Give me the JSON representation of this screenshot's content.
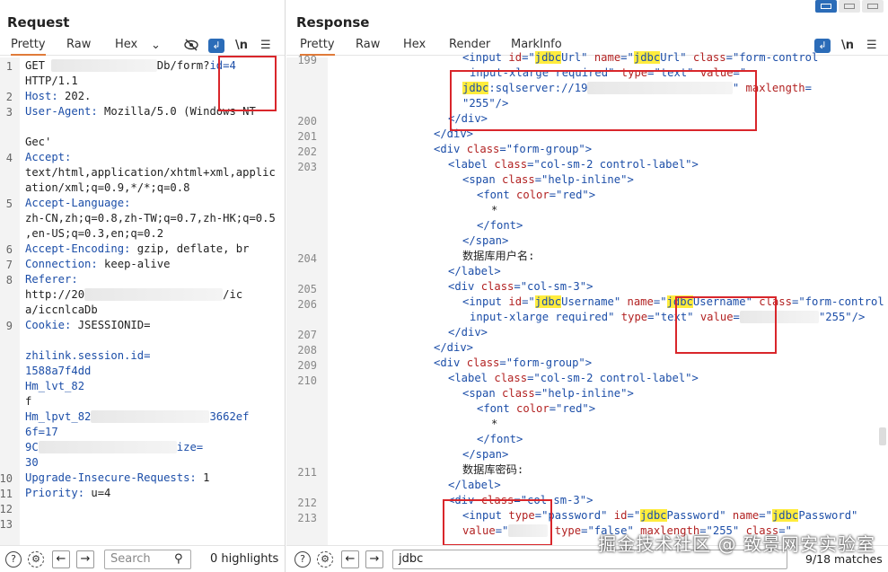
{
  "request": {
    "title": "Request",
    "tabs": [
      "Pretty",
      "Raw",
      "Hex"
    ],
    "newline_toggle": "\\n",
    "lines": [
      {
        "n": "1",
        "text": "GET "
      },
      {
        "n": "",
        "text": "HTTP/1.1"
      },
      {
        "n": "2",
        "text": "Host: 202."
      },
      {
        "n": "3",
        "text": "User-Agent: Mozilla/5.0 (Windows NT"
      },
      {
        "n": "",
        "text": ""
      },
      {
        "n": "",
        "text": "Gec'"
      },
      {
        "n": "4",
        "text": "Accept:"
      },
      {
        "n": "",
        "text": "text/html,application/xhtml+xml,applic"
      },
      {
        "n": "",
        "text": "ation/xml;q=0.9,*/*;q=0.8"
      },
      {
        "n": "5",
        "text": "Accept-Language:"
      },
      {
        "n": "",
        "text": "zh-CN,zh;q=0.8,zh-TW;q=0.7,zh-HK;q=0.5"
      },
      {
        "n": "",
        "text": ",en-US;q=0.3,en;q=0.2"
      },
      {
        "n": "6",
        "text": "Accept-Encoding: gzip, deflate, br"
      },
      {
        "n": "7",
        "text": "Connection: keep-alive"
      },
      {
        "n": "8",
        "text": "Referer:"
      },
      {
        "n": "",
        "text": "http://20"
      },
      {
        "n": "",
        "text": "a/iccnlcaDb"
      },
      {
        "n": "9",
        "text": "Cookie: JSESSIONID="
      },
      {
        "n": "",
        "text": ""
      },
      {
        "n": "",
        "text": "zhilink.session.id="
      },
      {
        "n": "",
        "text": "1588a7f4dd"
      },
      {
        "n": "",
        "text": "Hm_lvt_82"
      },
      {
        "n": "",
        "text": "f"
      },
      {
        "n": "",
        "text": "Hm_lpvt_82"
      },
      {
        "n": "",
        "text": "6f=17"
      },
      {
        "n": "",
        "text": "9C"
      },
      {
        "n": "",
        "text": "30"
      },
      {
        "n": "10",
        "text": "Upgrade-Insecure-Requests: 1"
      },
      {
        "n": "11",
        "text": "Priority: u=4"
      },
      {
        "n": "12",
        "text": ""
      },
      {
        "n": "13",
        "text": ""
      }
    ],
    "get_suffix": "Db/form?",
    "id_param": "id=4",
    "referer_suffix": "/ic",
    "hm_suffix": "3662ef",
    "size_suffix": "ize=",
    "search_placeholder": "Search",
    "highlights": "0 highlights"
  },
  "response": {
    "title": "Response",
    "tabs": [
      "Pretty",
      "Raw",
      "Hex",
      "Render",
      "MarkInfo"
    ],
    "newline_toggle": "\\n",
    "search_value": "jdbc",
    "matches": "9/18 matches",
    "watermark": "掘金技术社区 @ 致景网安实验室"
  }
}
